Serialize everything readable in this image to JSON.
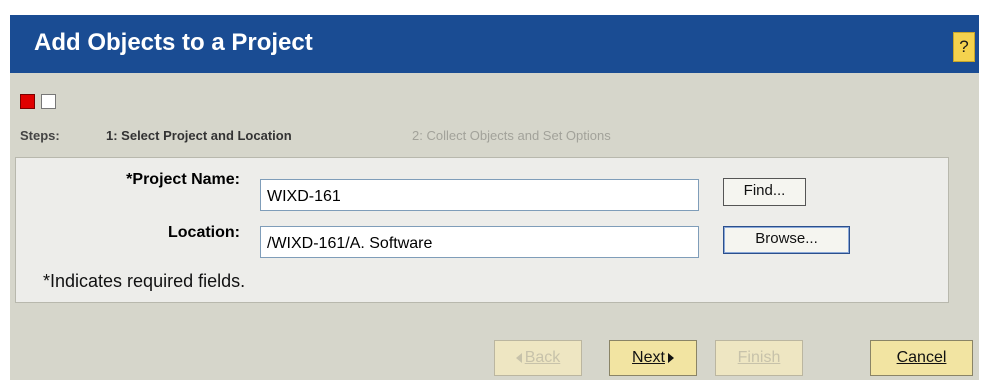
{
  "window": {
    "title": "Add Objects to a Project",
    "help_label": "?"
  },
  "steps": {
    "label": "Steps:",
    "items": [
      {
        "label": "1: Select Project and Location",
        "state": "current"
      },
      {
        "label": "2: Collect Objects and Set Options",
        "state": "upcoming"
      }
    ],
    "colors": {
      "active": "#e00000",
      "inactive": "#ffffff"
    }
  },
  "form": {
    "project_name": {
      "label": "*Project Name:",
      "value": "WIXD-161",
      "button_label": "Find..."
    },
    "location": {
      "label": "Location:",
      "value": "/WIXD-161/A. Software",
      "button_label": "Browse..."
    },
    "required_note": "*Indicates required fields."
  },
  "buttons": {
    "back": {
      "label": "Back",
      "enabled": false
    },
    "next": {
      "label": "Next",
      "enabled": true
    },
    "finish": {
      "label": "Finish",
      "enabled": false
    },
    "cancel": {
      "label": "Cancel",
      "enabled": true
    }
  },
  "colors": {
    "title_bar": "#1a4c93",
    "window_bg": "#d6d6cb",
    "panel_bg": "#ededea",
    "wizard_button": "#f2e4a2",
    "help_button": "#f4d24e"
  }
}
